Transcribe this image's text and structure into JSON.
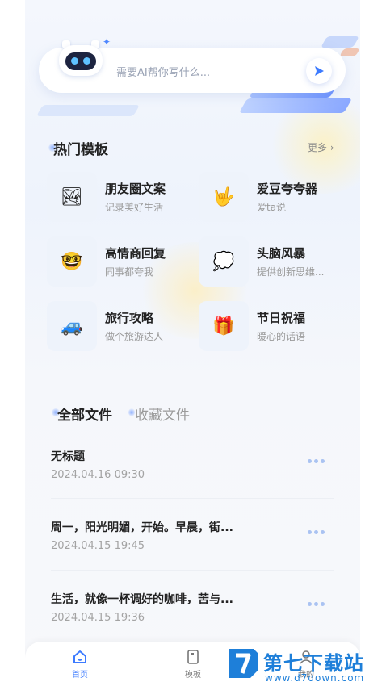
{
  "ai_input": {
    "placeholder": "需要AI帮你写什么..."
  },
  "hot_templates": {
    "title": "热门模板",
    "more": "更多",
    "items": [
      {
        "title": "朋友圈文案",
        "subtitle": "记录美好生活",
        "icon": "🏞"
      },
      {
        "title": "爱豆夸夸器",
        "subtitle": "爱ta说",
        "icon": "🤟"
      },
      {
        "title": "高情商回复",
        "subtitle": "同事都夸我",
        "icon": "🤓"
      },
      {
        "title": "头脑风暴",
        "subtitle": "提供创新思维...",
        "icon": "💭"
      },
      {
        "title": "旅行攻略",
        "subtitle": "做个旅游达人",
        "icon": "🚙"
      },
      {
        "title": "节日祝福",
        "subtitle": "暖心的话语",
        "icon": "🎁"
      }
    ]
  },
  "file_tabs": {
    "all": "全部文件",
    "favorites": "收藏文件"
  },
  "files": [
    {
      "title": "无标题",
      "date": "2024.04.16 09:30"
    },
    {
      "title": "周一，阳光明媚，开始。早晨，街...",
      "date": "2024.04.15 19:45"
    },
    {
      "title": "生活，就像一杯调好的咖啡，苦与...",
      "date": "2024.04.15 19:36"
    }
  ],
  "bottom_nav": {
    "home": "首页",
    "templates": "模板",
    "mine": "我的"
  },
  "colors": {
    "accent": "#3d7bff",
    "nav_active": "#3d7bff",
    "nav_inactive": "#777777"
  },
  "watermark": {
    "name": "第七下载站",
    "url": "www.d7down.com"
  }
}
